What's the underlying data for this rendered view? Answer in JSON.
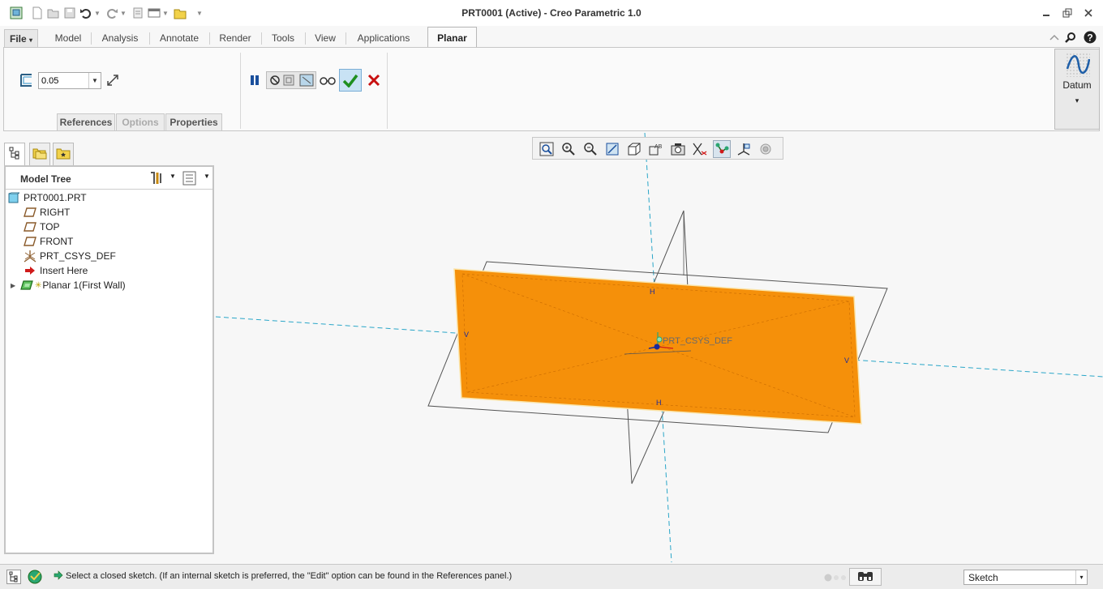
{
  "window": {
    "title": "PRT0001 (Active) - Creo Parametric 1.0",
    "minimize_icon": "minimize-icon",
    "restore_icon": "restore-icon",
    "close_icon": "close-icon"
  },
  "quick_access": [
    "app-logo-icon",
    "new-icon",
    "open-icon",
    "save-icon",
    "undo-icon",
    "redo-icon",
    "regenerate-icon",
    "windows-icon",
    "close-window-icon",
    "customize-icon"
  ],
  "ribbon_tabs": {
    "file": "File",
    "file_arrow": "▾",
    "model": "Model",
    "analysis": "Analysis",
    "annotate": "Annotate",
    "render": "Render",
    "tools": "Tools",
    "view": "View",
    "applications": "Applications",
    "planar": "Planar"
  },
  "dashboard": {
    "thickness_value": "0.05",
    "references": "References",
    "options": "Options",
    "properties": "Properties"
  },
  "datum": {
    "label": "Datum",
    "arrow": "▾"
  },
  "model_tree": {
    "header": "Model Tree",
    "items": [
      {
        "label": "PRT0001.PRT",
        "icon": "part-icon"
      },
      {
        "label": "RIGHT",
        "icon": "datum-plane-icon"
      },
      {
        "label": "TOP",
        "icon": "datum-plane-icon"
      },
      {
        "label": "FRONT",
        "icon": "datum-plane-icon"
      },
      {
        "label": "PRT_CSYS_DEF",
        "icon": "csys-icon"
      },
      {
        "label": "Insert Here",
        "icon": "insert-arrow-icon"
      },
      {
        "label": "Planar 1(First Wall)",
        "icon": "sheetmetal-wall-icon"
      }
    ]
  },
  "viewport": {
    "csys_label": "PRT_CSYS_DEF",
    "plane_tag_h": "H",
    "plane_tag_v": "V"
  },
  "status": {
    "message": "Select a closed sketch. (If an internal sketch is preferred, the \"Edit\" option can be found in the References panel.)",
    "filter": "Sketch",
    "filter_arrow": "▾"
  },
  "colors": {
    "surface": "#f5900a",
    "datum_axis": "#2aa6c8",
    "accept": "#1f8f1f",
    "cancel": "#c81010"
  }
}
